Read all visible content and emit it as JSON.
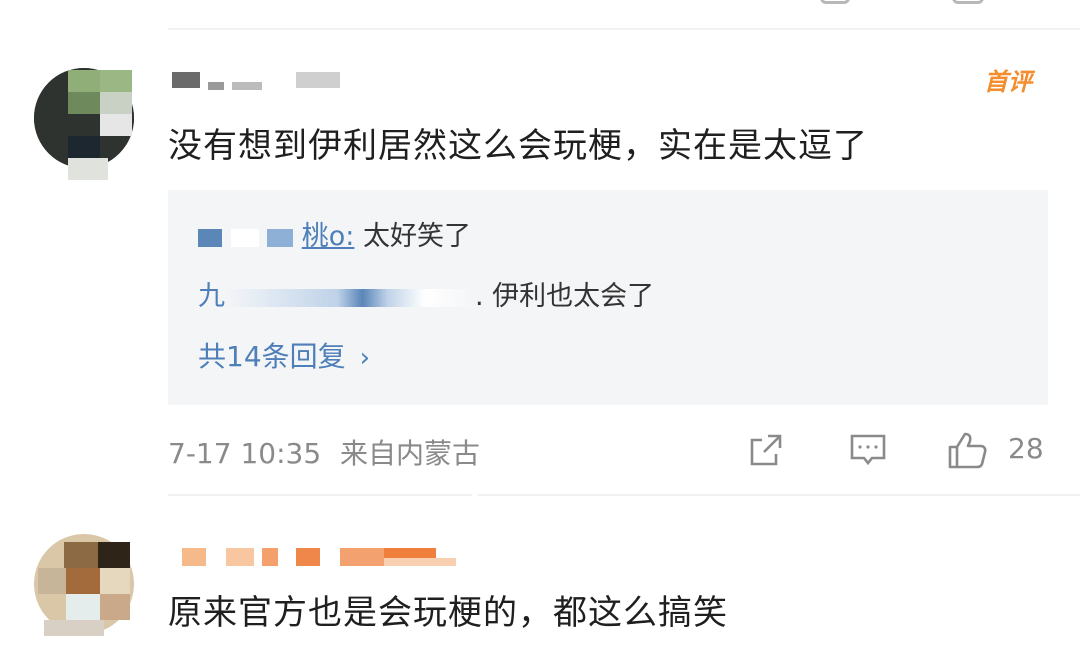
{
  "comments": [
    {
      "badge": "首评",
      "text": "没有想到伊利居然这么会玩梗，实在是太逗了",
      "replies": [
        {
          "name_suffix": "桃o:",
          "text": " 太好笑了"
        },
        {
          "name_prefix": "九",
          "name_suffix": ".",
          "text": " 伊利也太会了"
        }
      ],
      "reply_count_label": "共14条回复",
      "reply_chevron": "›",
      "timestamp": "7-17 10:35",
      "location": "来自内蒙古",
      "icons": [
        "share-icon",
        "comment-icon",
        "like-icon"
      ],
      "like_count": "28"
    },
    {
      "text": "原来官方也是会玩梗的，都这么搞笑"
    }
  ],
  "colors": {
    "link": "#4f7fb8",
    "badge": "#f38d2e",
    "reply_bg": "#f4f5f7",
    "meta": "#8a8a8a"
  }
}
